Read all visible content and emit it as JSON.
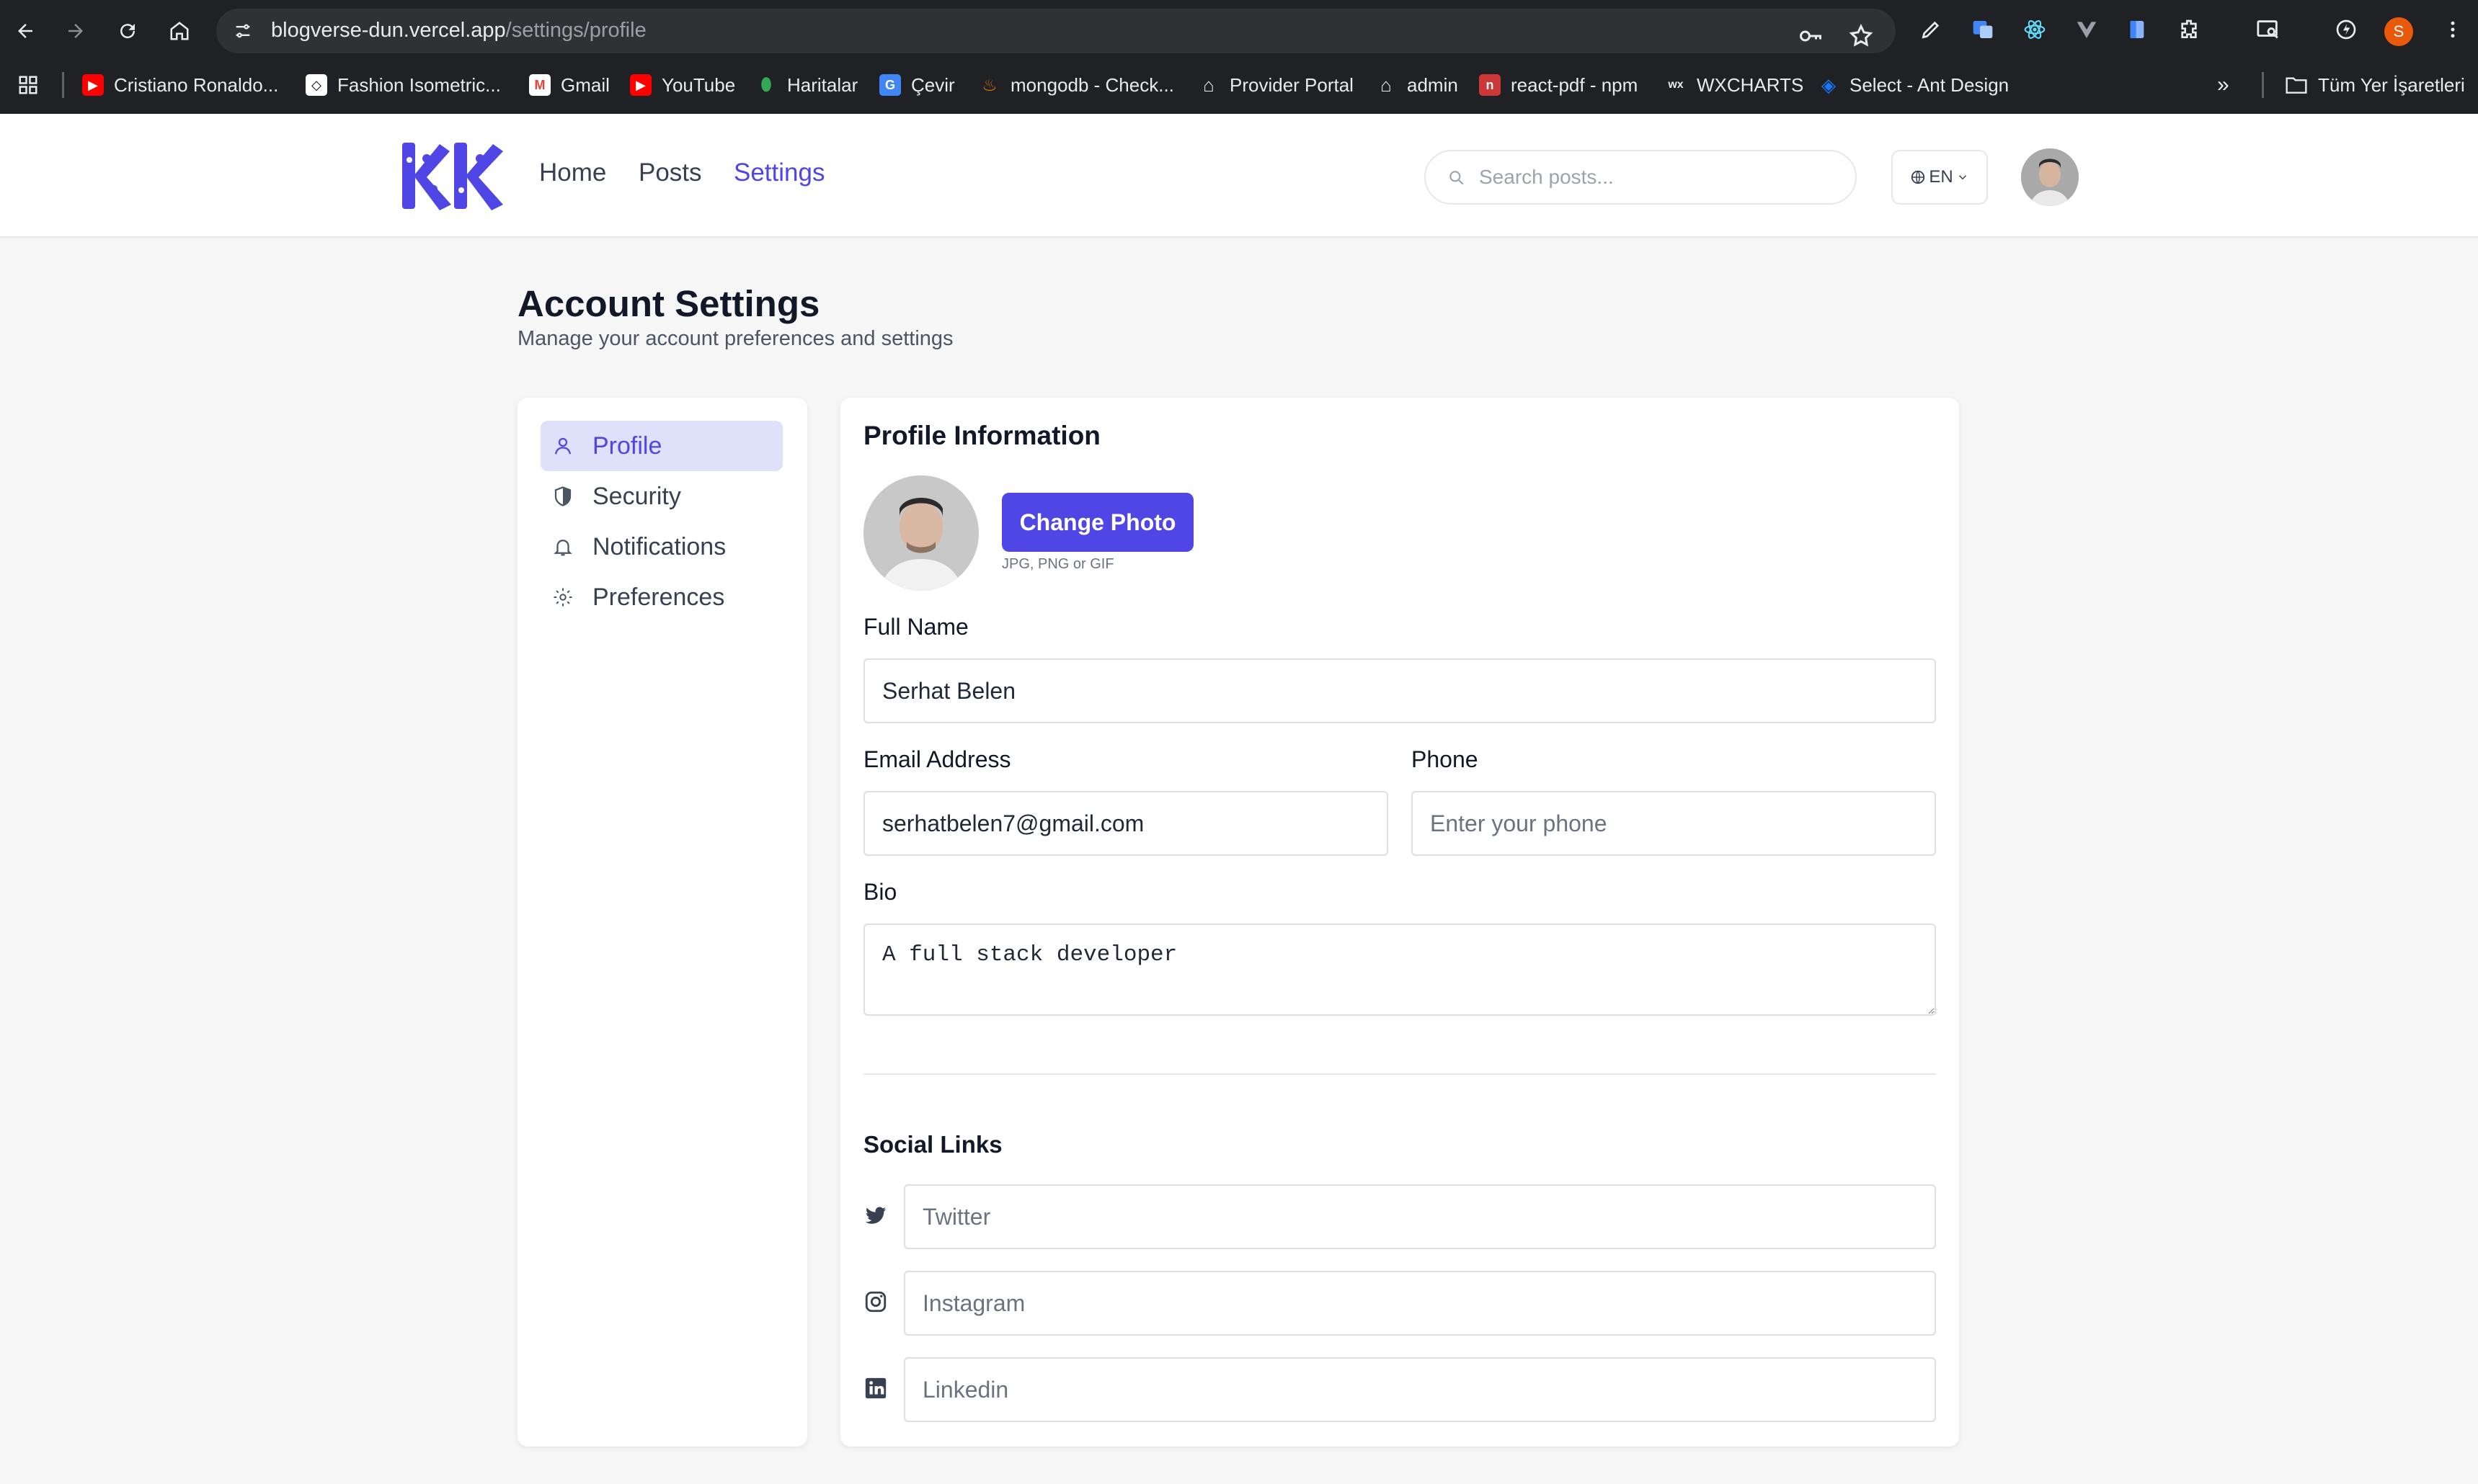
{
  "browser": {
    "url_host": "blogverse-dun.vercel.app",
    "url_path": "/settings/profile",
    "profile_initial": "S",
    "bookmarks": [
      {
        "label": "Cristiano Ronaldo...",
        "icon": "youtube-icon",
        "color": "#ff0000"
      },
      {
        "label": "Fashion Isometric...",
        "icon": "codepen-icon",
        "color": "#ffffff"
      },
      {
        "label": "Gmail",
        "icon": "gmail-icon",
        "color": "#ea4335"
      },
      {
        "label": "YouTube",
        "icon": "youtube-icon",
        "color": "#ff0000"
      },
      {
        "label": "Haritalar",
        "icon": "maps-icon",
        "color": "#34a853"
      },
      {
        "label": "Çevir",
        "icon": "translate-icon",
        "color": "#4285f4"
      },
      {
        "label": "mongodb - Check...",
        "icon": "mongodb-icon",
        "color": "#b45309"
      },
      {
        "label": "Provider Portal",
        "icon": "home-icon",
        "color": "#1f2937"
      },
      {
        "label": "admin",
        "icon": "home-icon",
        "color": "#1f2937"
      },
      {
        "label": "react-pdf - npm",
        "icon": "npm-icon",
        "color": "#cb3837"
      },
      {
        "label": "WXCHARTS",
        "icon": "wx-icon",
        "color": "#202124"
      },
      {
        "label": "Select - Ant Design",
        "icon": "antd-icon",
        "color": "#1677ff"
      }
    ],
    "all_bookmarks_label": "Tüm Yer İşaretleri"
  },
  "header": {
    "nav": {
      "home": "Home",
      "posts": "Posts",
      "settings": "Settings"
    },
    "search_placeholder": "Search posts...",
    "language": "EN"
  },
  "page": {
    "title": "Account Settings",
    "subtitle": "Manage your account preferences and settings"
  },
  "sidebar": {
    "items": [
      {
        "label": "Profile",
        "icon": "user-icon",
        "active": true
      },
      {
        "label": "Security",
        "icon": "shield-icon",
        "active": false
      },
      {
        "label": "Notifications",
        "icon": "bell-icon",
        "active": false
      },
      {
        "label": "Preferences",
        "icon": "gear-icon",
        "active": false
      }
    ]
  },
  "profile": {
    "section_title": "Profile Information",
    "change_photo_label": "Change Photo",
    "photo_hint": "JPG, PNG or GIF",
    "full_name_label": "Full Name",
    "full_name_value": "Serhat Belen",
    "email_label": "Email Address",
    "email_value": "serhatbelen7@gmail.com",
    "phone_label": "Phone",
    "phone_placeholder": "Enter your phone",
    "bio_label": "Bio",
    "bio_value": "A full stack developer"
  },
  "social": {
    "section_title": "Social Links",
    "twitter_placeholder": "Twitter",
    "instagram_placeholder": "Instagram",
    "linkedin_placeholder": "Linkedin"
  },
  "colors": {
    "accent": "#4f46e5",
    "accent_soft": "#dfe1fb",
    "page_bg": "#f6f6f7",
    "chrome_bg": "#202124"
  }
}
